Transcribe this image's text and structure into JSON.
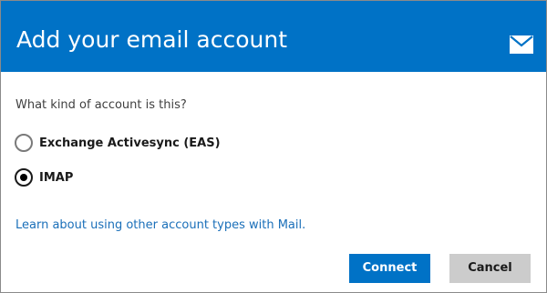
{
  "dialog": {
    "title": "Add your email account",
    "icon": "mail-icon",
    "question": "What kind of account is this?",
    "options": [
      {
        "label": "Exchange Activesync (EAS)",
        "selected": false
      },
      {
        "label": "IMAP",
        "selected": true
      }
    ],
    "learn_link": "Learn about using other account types with Mail.",
    "connect_label": "Connect",
    "cancel_label": "Cancel"
  },
  "colors": {
    "header_bg": "#0072c6",
    "primary_button": "#0072c6",
    "secondary_button": "#cccccc",
    "link": "#1a6fb9"
  }
}
